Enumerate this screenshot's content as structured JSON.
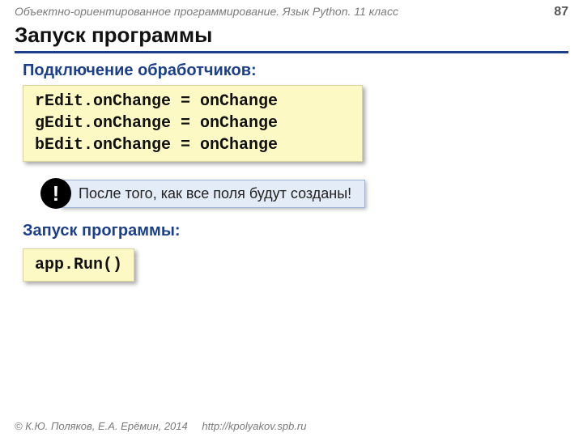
{
  "header": {
    "course": "Объектно-ориентированное программирование. Язык Python. 11 класс",
    "page": "87"
  },
  "title": "Запуск программы",
  "sections": {
    "handlers_label": "Подключение обработчиков:",
    "handlers_code": "rEdit.onChange = onChange\ngEdit.onChange = onChange\nbEdit.onChange = onChange",
    "callout_mark": "!",
    "callout_text": "После того, как все поля будут созданы!",
    "run_label": "Запуск программы:",
    "run_code": "app.Run()"
  },
  "footer": {
    "copyright": "© К.Ю. Поляков, Е.А. Ерёмин, 2014",
    "url": "http://kpolyakov.spb.ru"
  }
}
